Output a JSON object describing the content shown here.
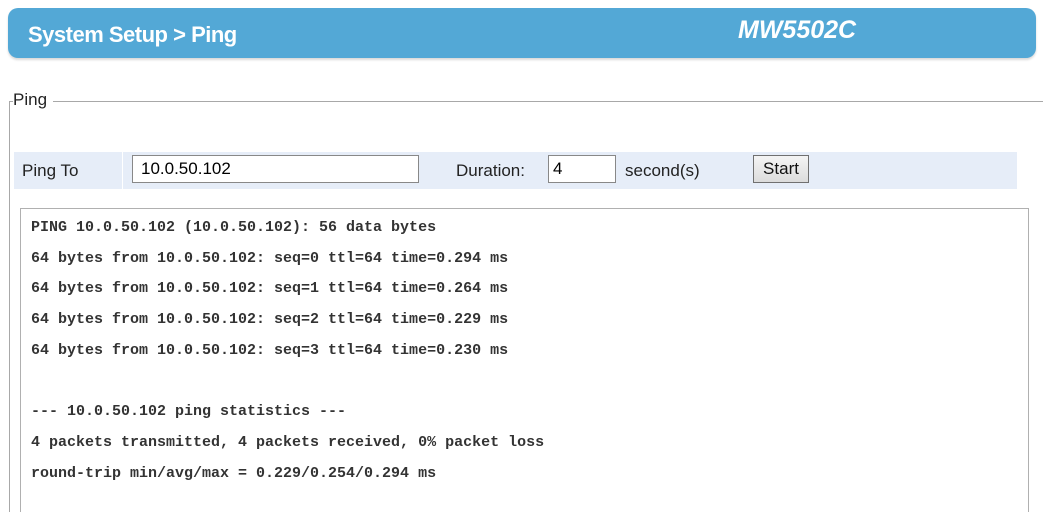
{
  "header": {
    "breadcrumb": "System Setup > Ping",
    "model": "MW5502C"
  },
  "ping_panel": {
    "legend": "Ping",
    "ping_to_label": "Ping To",
    "ping_to_value": "10.0.50.102",
    "duration_label": "Duration:",
    "duration_value": "4",
    "seconds_label": "second(s)",
    "start_label": "Start"
  },
  "output": {
    "lines": [
      "PING 10.0.50.102 (10.0.50.102): 56 data bytes",
      "64 bytes from 10.0.50.102: seq=0 ttl=64 time=0.294 ms",
      "64 bytes from 10.0.50.102: seq=1 ttl=64 time=0.264 ms",
      "64 bytes from 10.0.50.102: seq=2 ttl=64 time=0.229 ms",
      "64 bytes from 10.0.50.102: seq=3 ttl=64 time=0.230 ms",
      "",
      "--- 10.0.50.102 ping statistics ---",
      "4 packets transmitted, 4 packets received, 0% packet loss",
      "round-trip min/avg/max = 0.229/0.254/0.294 ms"
    ]
  }
}
